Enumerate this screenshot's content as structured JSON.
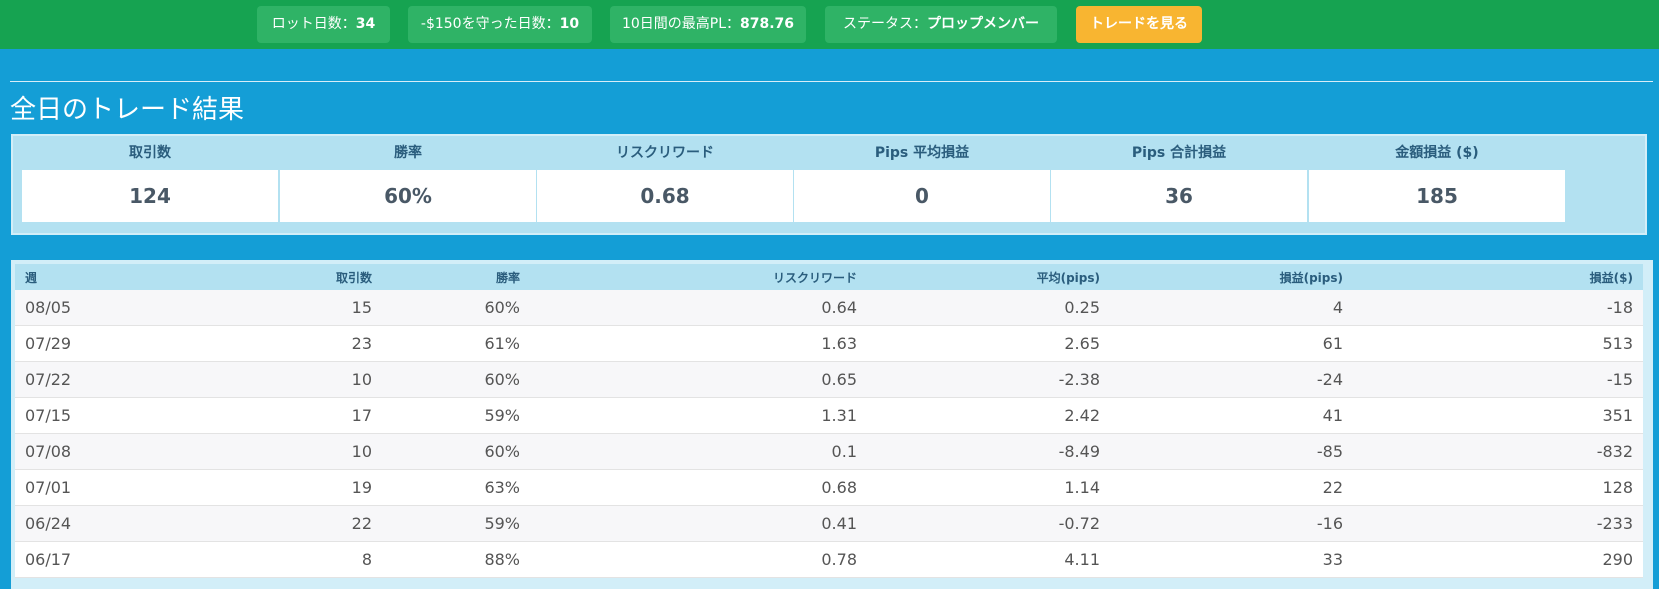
{
  "topbar": {
    "pills": [
      {
        "label": "ロット日数：",
        "value": "34"
      },
      {
        "label": "-$150を守った日数：",
        "value": "10"
      },
      {
        "label": "10日間の最高PL：",
        "value": "878.76"
      },
      {
        "label": "ステータス：",
        "value": "プロップメンバー"
      }
    ],
    "button_label": "トレードを見る",
    "colors": {
      "bar": "#16a351",
      "pill": "#2fb366",
      "button": "#f8b531"
    }
  },
  "section_title": "全日のトレード結果",
  "stats": [
    {
      "label": "取引数",
      "value": "124"
    },
    {
      "label": "勝率",
      "value": "60%"
    },
    {
      "label": "リスクリワード",
      "value": "0.68"
    },
    {
      "label": "Pips 平均損益",
      "value": "0"
    },
    {
      "label": "Pips 合計損益",
      "value": "36"
    },
    {
      "label": "金額損益 ($)",
      "value": "185"
    }
  ],
  "table": {
    "headers": [
      "週",
      "取引数",
      "勝率",
      "リスクリワード",
      "平均(pips)",
      "損益(pips)",
      "損益($)"
    ],
    "rows": [
      [
        "08/05",
        "15",
        "60%",
        "0.64",
        "0.25",
        "4",
        "-18"
      ],
      [
        "07/29",
        "23",
        "61%",
        "1.63",
        "2.65",
        "61",
        "513"
      ],
      [
        "07/22",
        "10",
        "60%",
        "0.65",
        "-2.38",
        "-24",
        "-15"
      ],
      [
        "07/15",
        "17",
        "59%",
        "1.31",
        "2.42",
        "41",
        "351"
      ],
      [
        "07/08",
        "10",
        "60%",
        "0.1",
        "-8.49",
        "-85",
        "-832"
      ],
      [
        "07/01",
        "19",
        "63%",
        "0.68",
        "1.14",
        "22",
        "128"
      ],
      [
        "06/24",
        "22",
        "59%",
        "0.41",
        "-0.72",
        "-16",
        "-233"
      ],
      [
        "06/17",
        "8",
        "88%",
        "0.78",
        "4.11",
        "33",
        "290"
      ]
    ]
  },
  "colors": {
    "page_bg": "#149ed6",
    "panel": "#b3e1f1"
  }
}
